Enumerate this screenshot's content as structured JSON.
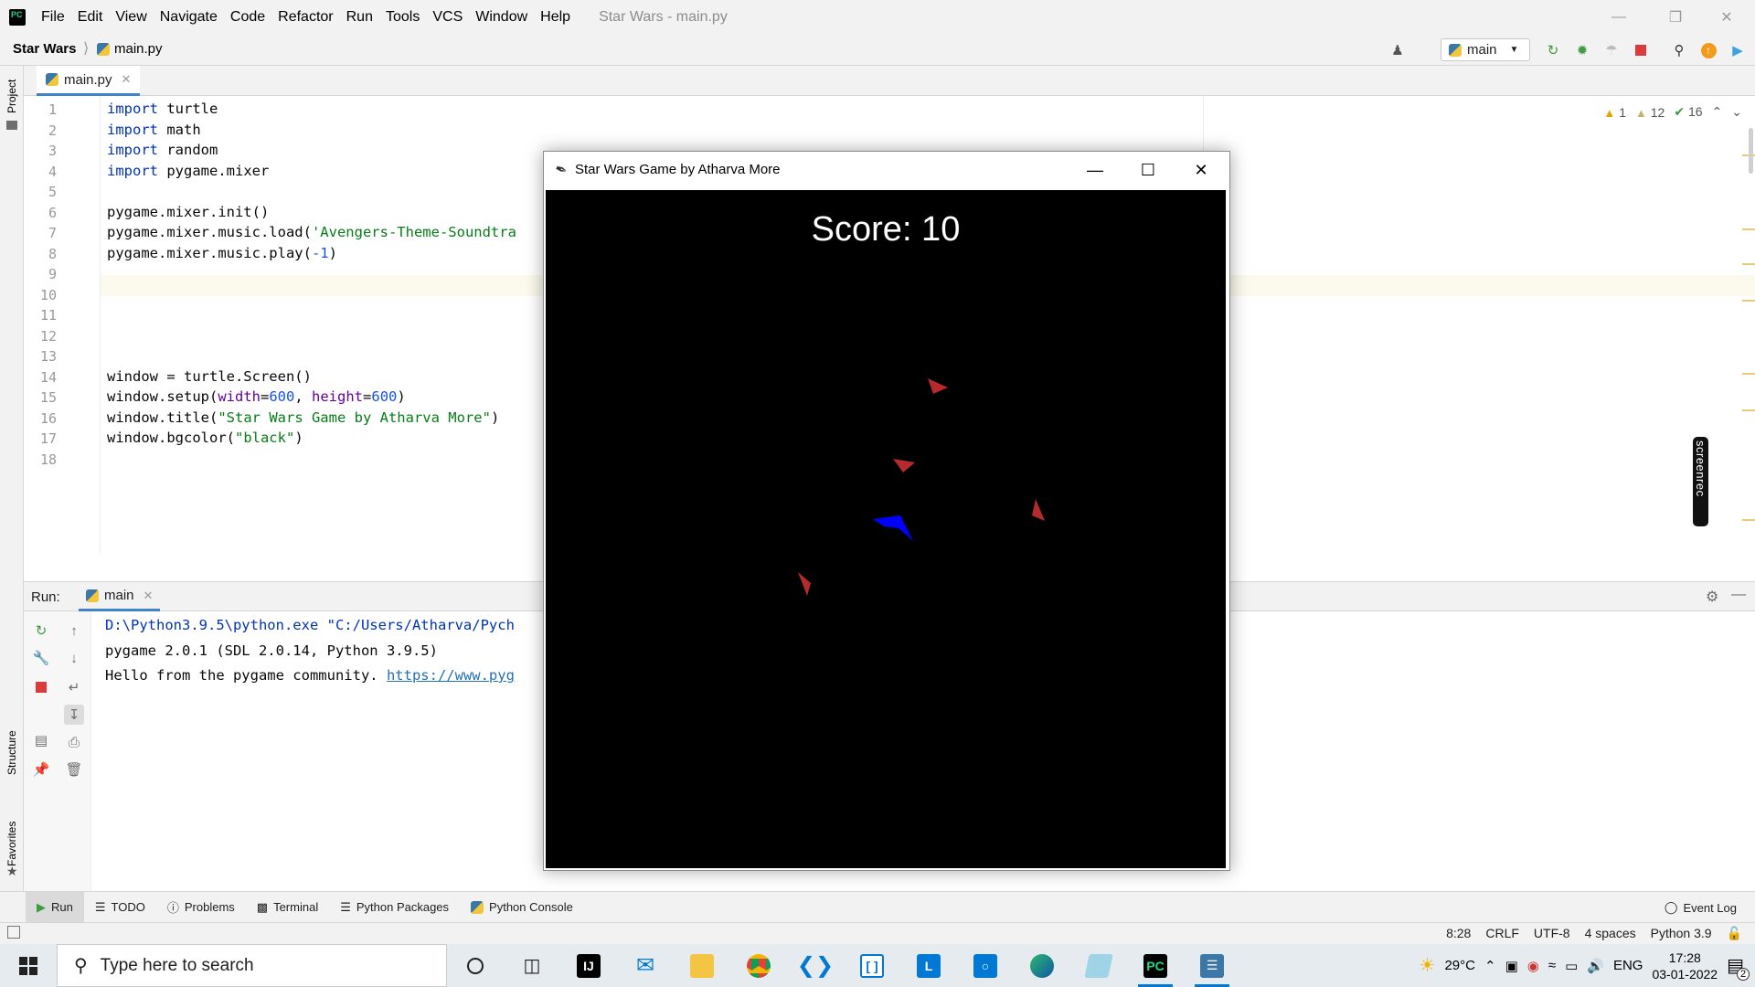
{
  "menubar": {
    "items": [
      "File",
      "Edit",
      "View",
      "Navigate",
      "Code",
      "Refactor",
      "Run",
      "Tools",
      "VCS",
      "Window",
      "Help"
    ],
    "window_title": "Star Wars - main.py"
  },
  "navbar": {
    "project": "Star Wars",
    "file": "main.py",
    "run_config": "main"
  },
  "left_strip": {
    "project": "Project",
    "structure": "Structure",
    "favorites": "Favorites"
  },
  "editor": {
    "tab_label": "main.py",
    "inspections": {
      "warnings": "1",
      "weak_warnings": "12",
      "typos": "16"
    },
    "line_numbers": [
      "1",
      "2",
      "3",
      "4",
      "5",
      "6",
      "7",
      "8",
      "9",
      "10",
      "11",
      "12",
      "13",
      "14",
      "15",
      "16",
      "17",
      "18"
    ],
    "lines": {
      "l1_kw": "import",
      "l1_rest": " turtle",
      "l2_kw": "import",
      "l2_rest": " math",
      "l3_kw": "import",
      "l3_rest": " random",
      "l4_kw": "import",
      "l4_rest": " pygame.mixer",
      "l6": "pygame.mixer.init()",
      "l7_a": "pygame.mixer.music.load(",
      "l7_str": "'Avengers-Theme-Soundtra",
      "l8_a": "pygame.mixer.music.play(",
      "l8_num": "-1",
      "l8_b": ")",
      "l14": "window = turtle.Screen()",
      "l15_a": "window.setup(",
      "l15_p1": "width",
      "l15_eq1": "=",
      "l15_n1": "600",
      "l15_sep": ", ",
      "l15_p2": "height",
      "l15_eq2": "=",
      "l15_n2": "600",
      "l15_b": ")",
      "l16_a": "window.title(",
      "l16_str": "\"Star Wars Game by Atharva More\"",
      "l16_b": ")",
      "l17_a": "window.bgcolor(",
      "l17_str": "\"black\"",
      "l17_b": ")"
    },
    "overlay_badge": "screenrec"
  },
  "run_panel": {
    "label": "Run:",
    "tab": "main",
    "console": {
      "line1": "D:\\Python3.9.5\\python.exe \"C:/Users/Atharva/Pych",
      "line2": "pygame 2.0.1 (SDL 2.0.14, Python 3.9.5)",
      "line3_text": "Hello from the pygame community. ",
      "line3_link": "https://www.pyg"
    }
  },
  "tool_tabs": {
    "run": "Run",
    "todo": "TODO",
    "problems": "Problems",
    "terminal": "Terminal",
    "python_packages": "Python Packages",
    "python_console": "Python Console",
    "event_log": "Event Log"
  },
  "statusbar": {
    "position": "8:28",
    "line_sep": "CRLF",
    "encoding": "UTF-8",
    "indent": "4 spaces",
    "interpreter": "Python 3.9"
  },
  "game_window": {
    "title": "Star Wars Game by Atharva More",
    "score": "Score: 10",
    "colors": {
      "background": "#000000",
      "player": "#0000ff",
      "enemy": "#b52b2b"
    }
  },
  "taskbar": {
    "search_placeholder": "Type here to search",
    "weather": "29°C",
    "language": "ENG",
    "time": "17:28",
    "date": "03-01-2022",
    "notification_count": "2"
  }
}
